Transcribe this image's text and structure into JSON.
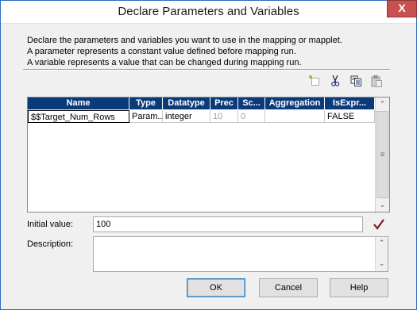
{
  "window": {
    "title": "Declare Parameters and Variables",
    "close_symbol": "X"
  },
  "description_lines": [
    "Declare the parameters and variables you want to use in the mapping or mapplet.",
    "A parameter represents a constant value defined before mapping run.",
    "A variable represents a value that can be changed during mapping run."
  ],
  "toolbar": {
    "icons": [
      "new-icon",
      "cut-icon",
      "copy-icon",
      "paste-icon"
    ]
  },
  "grid": {
    "columns": [
      "Name",
      "Type",
      "Datatype",
      "Prec",
      "Sc...",
      "Aggregation",
      "IsExpr..."
    ],
    "rows": [
      {
        "name": "$$Target_Num_Rows",
        "type": "Param...",
        "datatype": "integer",
        "prec": "10",
        "scale": "0",
        "aggregation": "",
        "isexpr": "FALSE"
      }
    ]
  },
  "form": {
    "initial_value_label": "Initial value:",
    "initial_value": "100",
    "description_label": "Description:",
    "description_value": ""
  },
  "buttons": {
    "ok": "OK",
    "cancel": "Cancel",
    "help": "Help"
  },
  "colors": {
    "header_bg": "#0a3a7a",
    "check_color": "#8b1a1a",
    "close_bg": "#c75050"
  }
}
